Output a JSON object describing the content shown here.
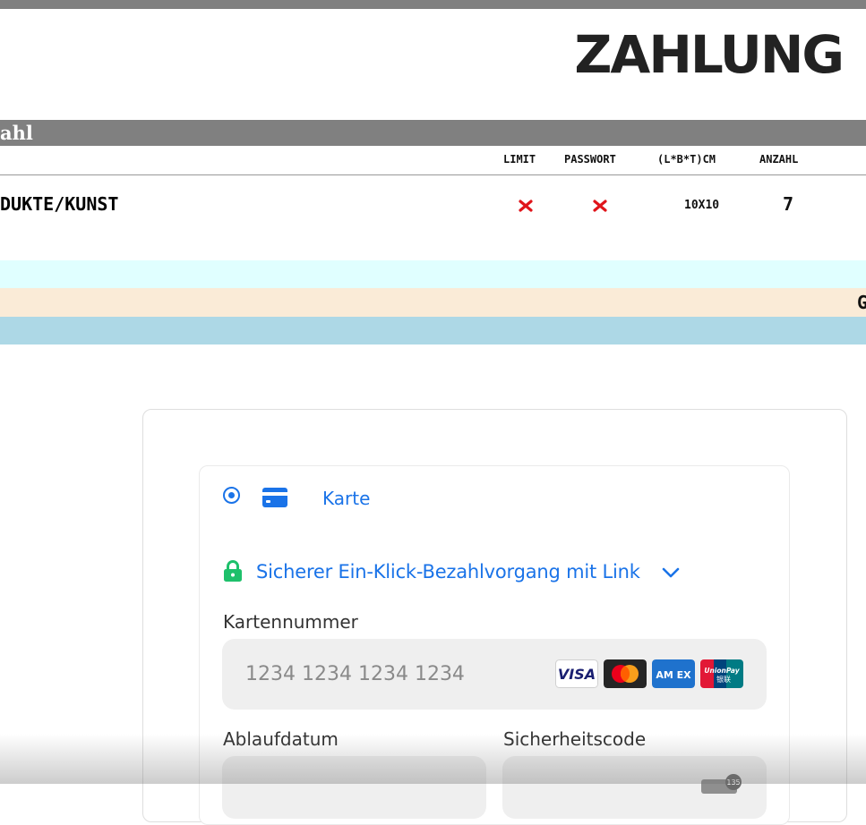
{
  "header": {
    "title": "ZAHLUNG"
  },
  "section": {
    "label": "ahl"
  },
  "table": {
    "columns": [
      "LIMIT",
      "PASSWORT",
      "(L*B*T)CM",
      "ANZAHL"
    ],
    "row": {
      "name": "DUKTE/KUNST",
      "limit_icon": "red-cross-icon",
      "password_icon": "red-cross-icon",
      "size": "10X10",
      "quantity": "7"
    }
  },
  "bands": {
    "middle_text": "G"
  },
  "payment": {
    "tab_label": "Karte",
    "tab_icon": "credit-card-icon",
    "link_text": "Sicherer Ein-Klick-Bezahlvorgang mit Link",
    "card_number_label": "Kartennummer",
    "card_number_placeholder": "1234 1234 1234 1234",
    "expiry_label": "Ablaufdatum",
    "cvc_label": "Sicherheitscode",
    "brands": [
      "VISA",
      "Mastercard",
      "AMEX",
      "UnionPay"
    ],
    "amex_text": "AM EX",
    "unionpay_text": "UnionPay",
    "unionpay_sub": "银联",
    "cvc_icon_text": "135",
    "colors": {
      "accent": "#1a73e8",
      "lock": "#1ec06b",
      "cross": "#e0151b"
    }
  }
}
